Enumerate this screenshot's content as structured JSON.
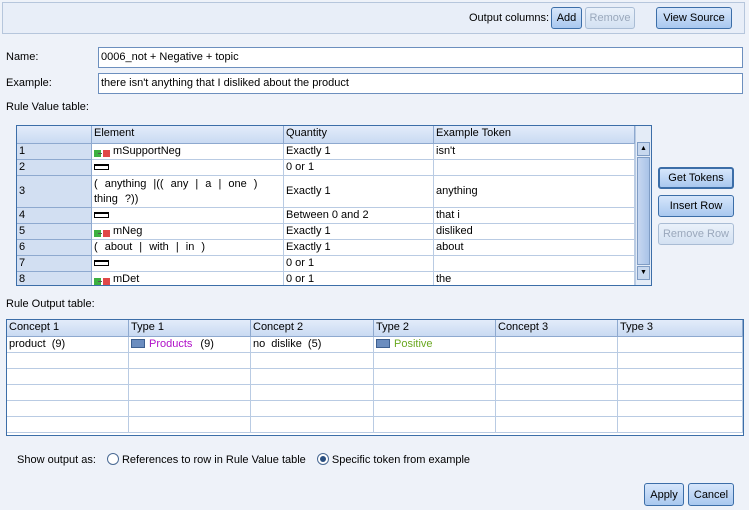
{
  "toolbar": {
    "output_columns_label": "Output columns:",
    "add_label": "Add",
    "remove_label": "Remove",
    "view_source_label": "View Source"
  },
  "form": {
    "name_label": "Name:",
    "name_value": "0006_not + Negative + topic",
    "example_label": "Example:",
    "example_value": "there isn't anything that I disliked about the product"
  },
  "rule_value": {
    "label": "Rule Value table:",
    "columns": [
      "Element",
      "Quantity",
      "Example Token"
    ],
    "rows": [
      {
        "num": "1",
        "icon": "macro-icon",
        "element": "mSupportNeg",
        "quantity": "Exactly 1",
        "token": "isn't"
      },
      {
        "num": "2",
        "icon": "word-gap-icon",
        "element": "",
        "quantity": "0 or 1",
        "token": ""
      },
      {
        "num": "3",
        "icon": "",
        "element": "( anything |(( any | a | one ) thing ?))",
        "quantity": "Exactly 1",
        "token": "anything"
      },
      {
        "num": "4",
        "icon": "word-gap-icon",
        "element": "",
        "quantity": "Between 0 and 2",
        "token": "that i"
      },
      {
        "num": "5",
        "icon": "macro-icon",
        "element": "mNeg",
        "quantity": "Exactly 1",
        "token": "disliked"
      },
      {
        "num": "6",
        "icon": "",
        "element": "( about | with | in )",
        "quantity": "Exactly 1",
        "token": "about"
      },
      {
        "num": "7",
        "icon": "word-gap-icon",
        "element": "",
        "quantity": "0 or 1",
        "token": ""
      },
      {
        "num": "8",
        "icon": "macro-icon",
        "element": "mDet",
        "quantity": "0 or 1",
        "token": "the"
      }
    ],
    "get_tokens_label": "Get Tokens",
    "insert_row_label": "Insert Row",
    "remove_row_label": "Remove Row"
  },
  "rule_output": {
    "label": "Rule Output table:",
    "columns": [
      "Concept 1",
      "Type 1",
      "Concept 2",
      "Type 2",
      "Concept 3",
      "Type 3"
    ],
    "rows": [
      {
        "concept1": "product  (9)",
        "type1": "Products",
        "type1_count": "(9)",
        "concept2": "no dislike  (5)",
        "type2": "Positive"
      }
    ]
  },
  "colors": {
    "products": "#b010c8",
    "positive": "#6aa820"
  },
  "show_output": {
    "label": "Show output as:",
    "option1": "References to row in Rule Value table",
    "option2": "Specific token from example",
    "selected": "option2"
  },
  "footer": {
    "apply_label": "Apply",
    "cancel_label": "Cancel"
  }
}
